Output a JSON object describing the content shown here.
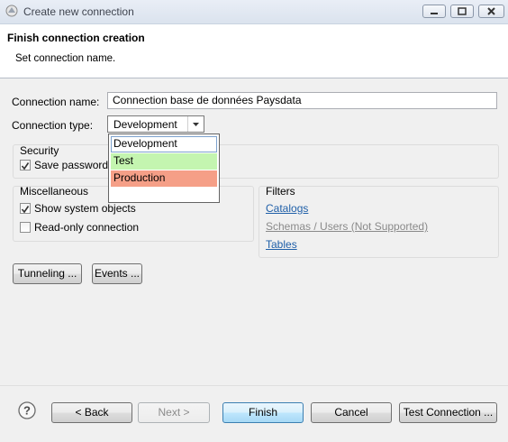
{
  "window": {
    "title": "Create new connection"
  },
  "header": {
    "title": "Finish connection creation",
    "subtitle": "Set connection name."
  },
  "form": {
    "name_label": "Connection name:",
    "name_value": "Connection base de données Paysdata",
    "type_label": "Connection type:",
    "type_value": "Development",
    "type_options": [
      {
        "label": "Development",
        "color": "#ffffff"
      },
      {
        "label": "Test",
        "color": "#c4f5b0"
      },
      {
        "label": "Production",
        "color": "#f59f87"
      }
    ]
  },
  "security": {
    "title": "Security",
    "save_password_label": "Save password l",
    "save_password_checked": true
  },
  "misc": {
    "title": "Miscellaneous",
    "show_system_objects_label": "Show system objects",
    "show_system_objects_checked": true,
    "read_only_label": "Read-only connection",
    "read_only_checked": false
  },
  "filters": {
    "title": "Filters",
    "catalogs": "Catalogs",
    "schemas": "Schemas / Users (Not Supported)",
    "tables": "Tables"
  },
  "buttons": {
    "tunneling": "Tunneling ...",
    "events": "Events ...",
    "back": "< Back",
    "next": "Next >",
    "finish": "Finish",
    "cancel": "Cancel",
    "test_connection": "Test Connection ..."
  },
  "colors": {
    "link": "#1f5fa8",
    "accent": "#3c7fb1"
  }
}
